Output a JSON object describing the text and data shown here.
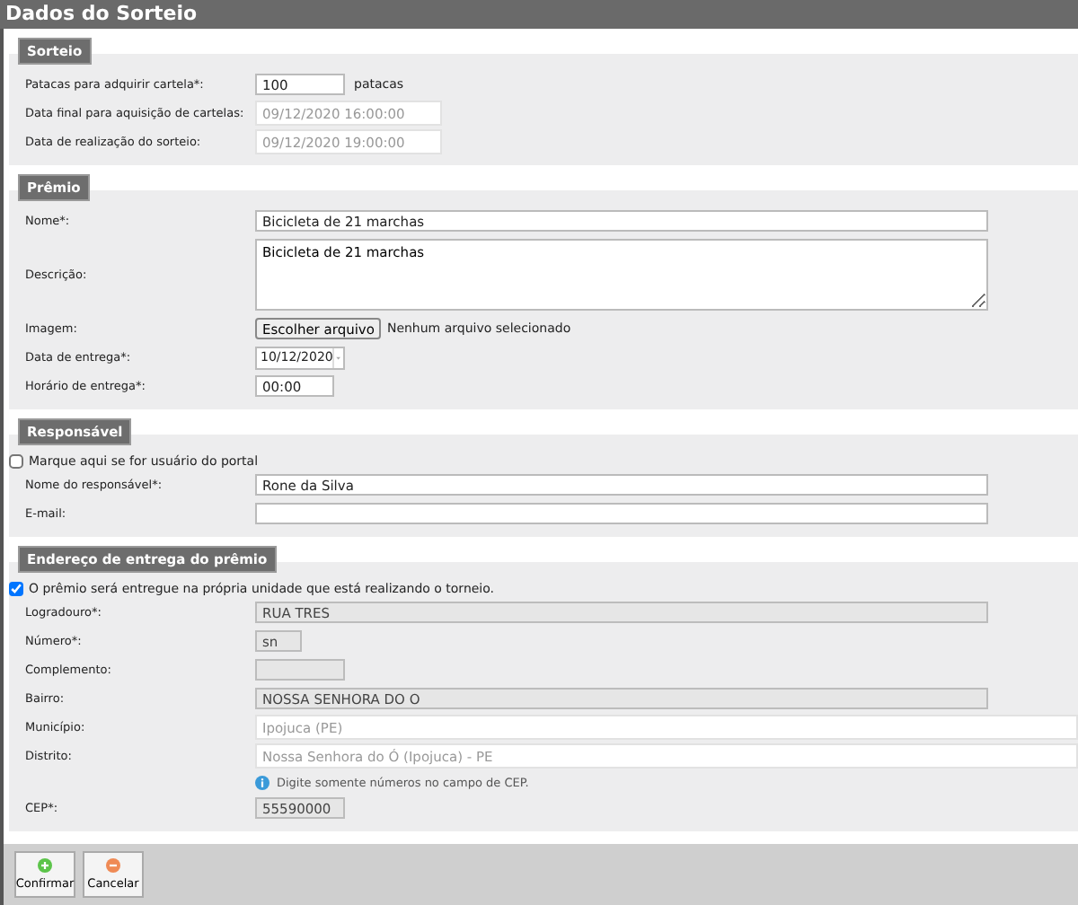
{
  "window": {
    "title": "Dados do Sorteio"
  },
  "sections": [
    {
      "title": "Sorteio",
      "rows": [
        {
          "kind": "input",
          "label": "Patacas para adquirir cartela*:",
          "value": "100",
          "suffix": "patacas"
        },
        {
          "kind": "readonly",
          "label": "Data final para aquisição de cartelas:",
          "value": "09/12/2020 16:00:00"
        },
        {
          "kind": "readonly",
          "label": "Data de realização do sorteio:",
          "value": "09/12/2020 19:00:00"
        }
      ]
    },
    {
      "title": "Prêmio",
      "rows": [
        {
          "kind": "input",
          "label": "Nome*:",
          "value": "Bicicleta de 21 marchas"
        },
        {
          "kind": "textarea",
          "label": "Descrição:",
          "value": "Bicicleta de 21 marchas"
        },
        {
          "kind": "file",
          "label": "Imagem:",
          "button": "Escolher arquivo",
          "value": "Nenhum arquivo selecionado"
        },
        {
          "kind": "date",
          "label": "Data de entrega*:",
          "value": "10/12/2020"
        },
        {
          "kind": "input",
          "label": "Horário de entrega*:",
          "value": "00:00"
        }
      ]
    },
    {
      "title": "Responsável",
      "rows": [
        {
          "kind": "checkbox",
          "label": "Marque aqui se for usuário do portal",
          "checked": false
        },
        {
          "kind": "input",
          "label": "Nome do responsável*:",
          "value": "Rone da Silva"
        },
        {
          "kind": "input",
          "label": "E-mail:"
        }
      ]
    },
    {
      "title": "Endereço de entrega do prêmio",
      "rows": [
        {
          "kind": "checkbox",
          "label": "O prêmio será entregue na própria unidade que está realizando o torneio.",
          "checked": true
        },
        {
          "kind": "locked",
          "label": "Logradouro*:",
          "value": "RUA TRES"
        },
        {
          "kind": "locked",
          "label": "Número*:",
          "value": "sn"
        },
        {
          "kind": "locked",
          "label": "Complemento:"
        },
        {
          "kind": "locked",
          "label": "Bairro:",
          "value": "NOSSA SENHORA DO O"
        },
        {
          "kind": "readonly",
          "label": "Município:",
          "value": "Ipojuca (PE)"
        },
        {
          "kind": "readonly",
          "label": "Distrito:",
          "value": "Nossa Senhora do Ó (Ipojuca) - PE"
        },
        {
          "kind": "hint",
          "value": "Digite somente números no campo de CEP."
        },
        {
          "kind": "locked",
          "label": "CEP*:",
          "value": "55590000"
        }
      ]
    }
  ],
  "buttons": [
    {
      "label": "Confirmar",
      "kind": "confirm"
    },
    {
      "label": "Cancelar",
      "kind": "cancel"
    }
  ]
}
